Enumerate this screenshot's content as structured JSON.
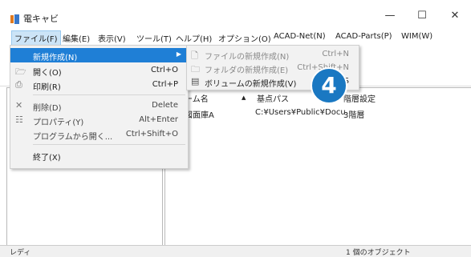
{
  "window": {
    "title": "電キャビ",
    "minimize": "—",
    "maximize": "☐",
    "close": "✕"
  },
  "menubar": [
    "ファイル(F)",
    "編集(E)",
    "表示(V)",
    "ツール(T)",
    "ヘルプ(H)",
    "オプション(O)",
    "ACAD-Net(N)",
    "ACAD-Parts(P)",
    "WIM(W)"
  ],
  "file_menu": {
    "new": "新規作成(N)",
    "open": "開く(O)",
    "open_sc": "Ctrl+O",
    "print": "印刷(R)",
    "print_sc": "Ctrl+P",
    "delete": "削除(D)",
    "delete_sc": "Delete",
    "props": "プロパティ(Y)",
    "props_sc": "Alt+Enter",
    "open_with": "プログラムから開く...",
    "open_with_sc": "Ctrl+Shift+O",
    "exit": "終了(X)"
  },
  "submenu": {
    "new_file": "ファイルの新規作成(N)",
    "new_file_sc": "Ctrl+N",
    "new_folder": "フォルダの新規作成(E)",
    "new_folder_sc": "Ctrl+Shift+N",
    "new_volume": "ボリュームの新規作成(V)",
    "new_volume_sc": "S"
  },
  "list": {
    "headers": {
      "name": "ーム名",
      "path": "基点パス",
      "floor": "階層設定"
    },
    "row": {
      "name": "図面庫A",
      "path": "C:¥Users¥Public¥Docu",
      "floor": "3階層"
    }
  },
  "status": {
    "left": "レディ",
    "right": "1 個のオブジェクト"
  },
  "badge": "4",
  "colors": {
    "highlight": "#1f7fd6",
    "badge": "#1a78c2"
  }
}
